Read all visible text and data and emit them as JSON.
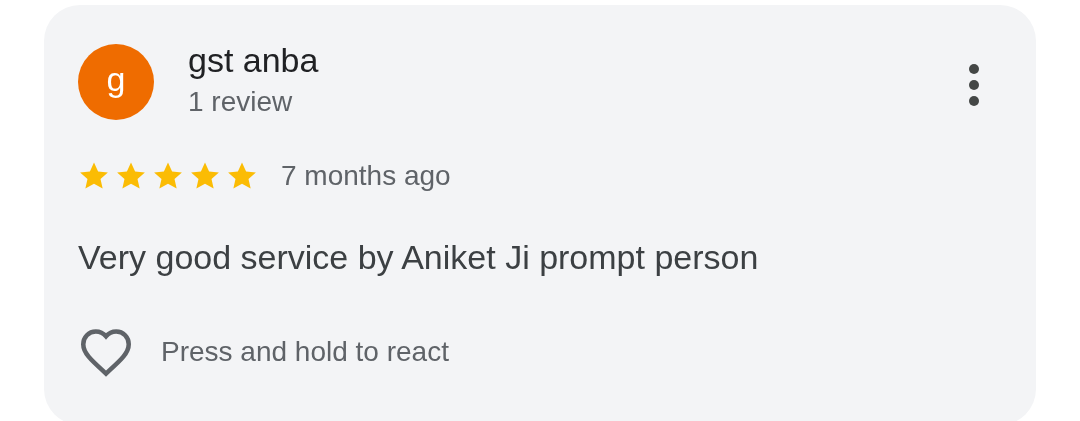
{
  "review": {
    "avatar_letter": "g",
    "author": "gst anba",
    "author_meta": "1 review",
    "stars": 5,
    "time": "7 months ago",
    "text": "Very good service by Aniket Ji prompt person",
    "react_hint": "Press and hold to react"
  }
}
